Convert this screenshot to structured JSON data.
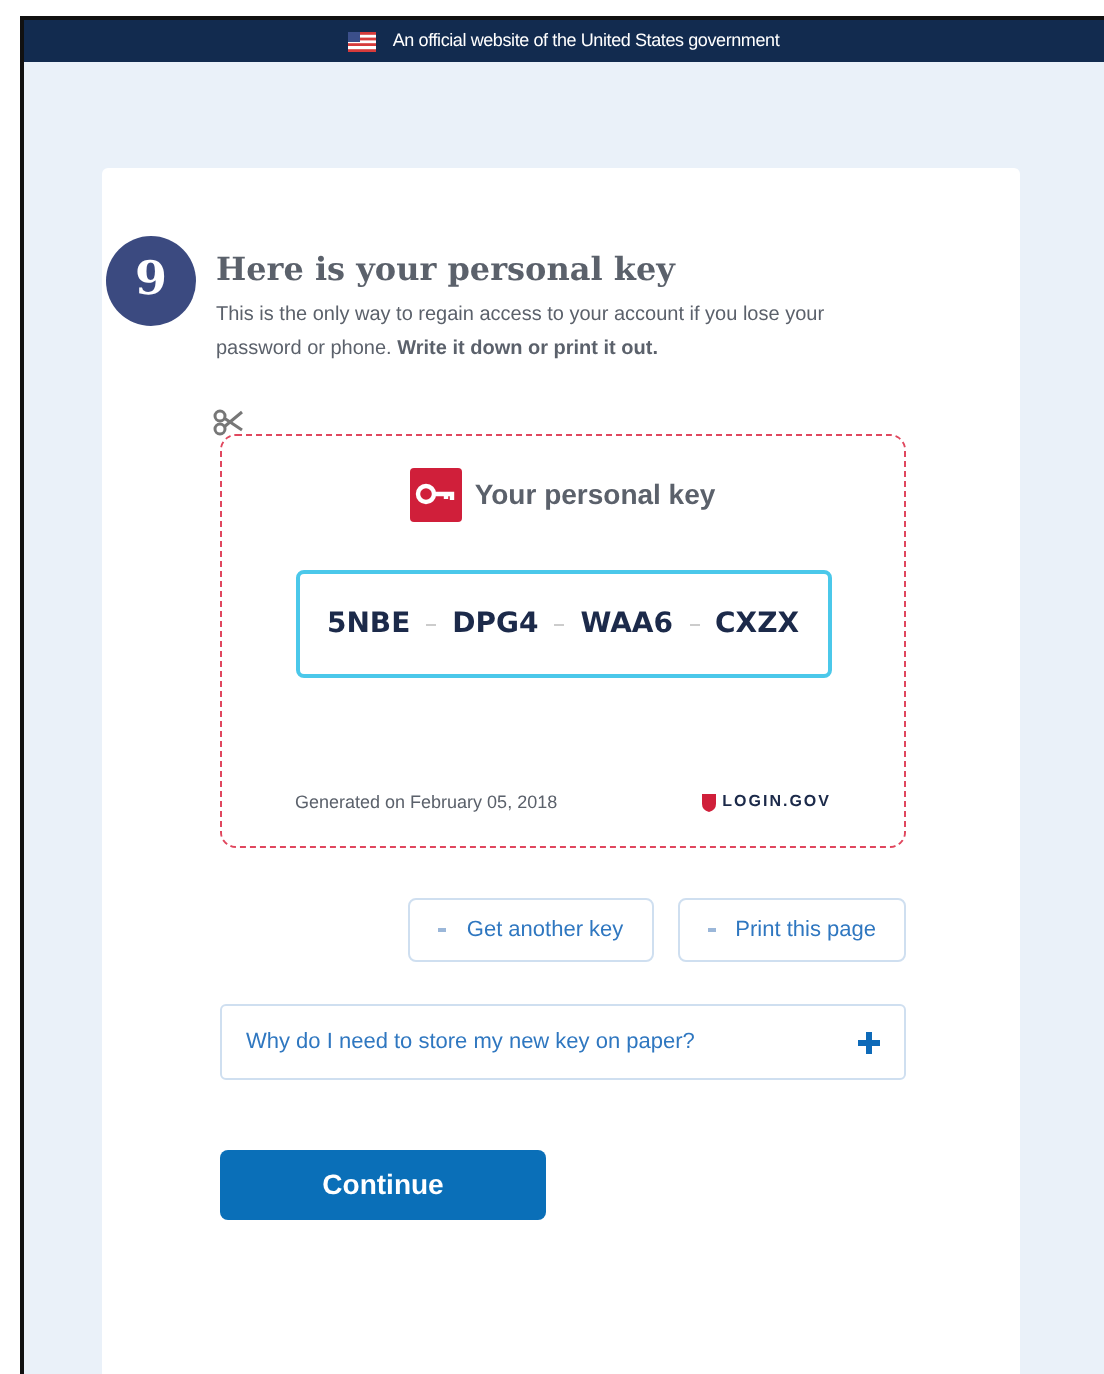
{
  "banner": {
    "text": "An official website of the United States government"
  },
  "step": {
    "number": "9",
    "title": "Here is your personal key",
    "intro": "This is the only way to regain access to your account if you lose your password or phone. **Write it down or print it out.**"
  },
  "key_card": {
    "title": "Your personal key",
    "chunks": [
      "5NBE",
      "DPG4",
      "WAA6",
      "CXZX"
    ],
    "generated": "Generated on February 05, 2018",
    "brand": "LOGIN.GOV"
  },
  "actions": [
    {
      "label": "Get another key"
    },
    {
      "label": "Print this page"
    }
  ],
  "accordion": {
    "label": "Why do I need to store my new key on paper?",
    "expanded": false
  },
  "continue_button": {
    "label": "Continue"
  }
}
